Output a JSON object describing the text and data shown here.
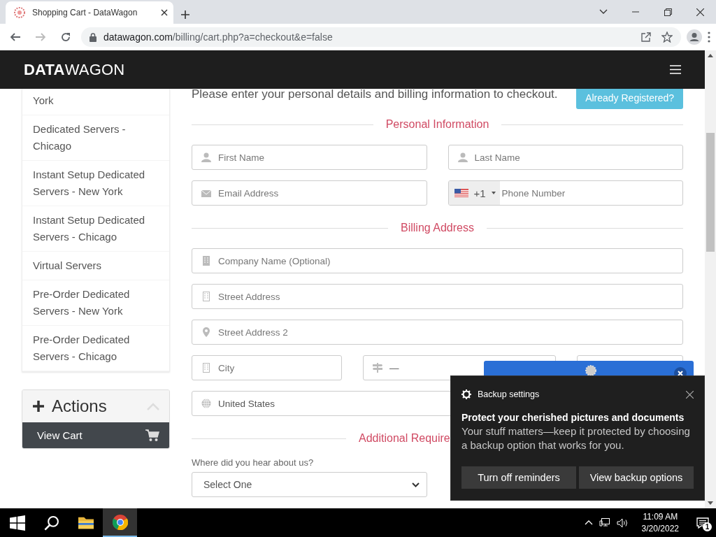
{
  "browser": {
    "tabs": [
      {
        "title": "Shopping Cart - DataWagon",
        "selected": true
      }
    ],
    "url_host": "datawagon.com",
    "url_path": "/billing/cart.php?a=checkout&e=false"
  },
  "site": {
    "logo": "**DATA**WAGON"
  },
  "sidebar": {
    "items": [
      "York",
      "Dedicated Servers - Chicago",
      "Instant Setup Dedicated Servers - New York",
      "Instant Setup Dedicated Servers - Chicago",
      "Virtual Servers",
      "Pre-Order Dedicated Servers - New York",
      "Pre-Order Dedicated Servers - Chicago"
    ],
    "actions": {
      "title": "Actions",
      "expanded": true,
      "items": [
        {
          "label": "View Cart"
        }
      ]
    }
  },
  "form": {
    "intro": "Please enter your personal details and billing information to checkout.",
    "login_button": "Already Registered?",
    "sections": [
      {
        "title": "Personal Information",
        "rows": [
          {
            "fields": [
              {
                "kind": "name",
                "placeholder": "First Name"
              },
              {
                "kind": "name",
                "placeholder": "Last Name"
              }
            ]
          },
          {
            "fields": [
              {
                "kind": "email",
                "placeholder": "Email Address"
              },
              {
                "kind": "phone",
                "code": "+1",
                "placeholder": "Phone Number"
              }
            ]
          }
        ]
      },
      {
        "title": "Billing Address",
        "rows": [
          {
            "fields": [
              {
                "kind": "company",
                "placeholder": "Company Name (Optional)"
              }
            ]
          },
          {
            "fields": [
              {
                "kind": "address",
                "placeholder": "Street Address"
              }
            ]
          },
          {
            "fields": [
              {
                "kind": "location",
                "placeholder": "Street Address 2"
              }
            ]
          },
          {
            "fields": [
              {
                "kind": "city",
                "placeholder": "City"
              },
              {
                "kind": "state",
                "value": "—"
              },
              {
                "kind": "postcode"
              }
            ]
          },
          {
            "fields": [
              {
                "kind": "country",
                "value": "United States"
              }
            ]
          }
        ]
      },
      {
        "title": "Additional Require",
        "rows": [
          {
            "fields": [
              {
                "kind": "select",
                "label": "Where did you hear about us?",
                "value": "Select One"
              }
            ]
          }
        ]
      }
    ]
  },
  "toast": {
    "title": "Backup settings",
    "heading": "Protect your cherished pictures and documents",
    "body": "Your stuff matters—keep it protected by choosing a backup option that works for you.",
    "buttons": [
      "Turn off reminders",
      "View backup options"
    ]
  },
  "taskbar": {
    "apps": [
      {
        "kind": "start",
        "selected": false
      },
      {
        "kind": "search",
        "selected": false
      },
      {
        "kind": "folder",
        "selected": false
      },
      {
        "kind": "chrome",
        "selected": true
      }
    ],
    "time": "11:09 AM",
    "date": "3/20/2022",
    "notifications": "1"
  }
}
